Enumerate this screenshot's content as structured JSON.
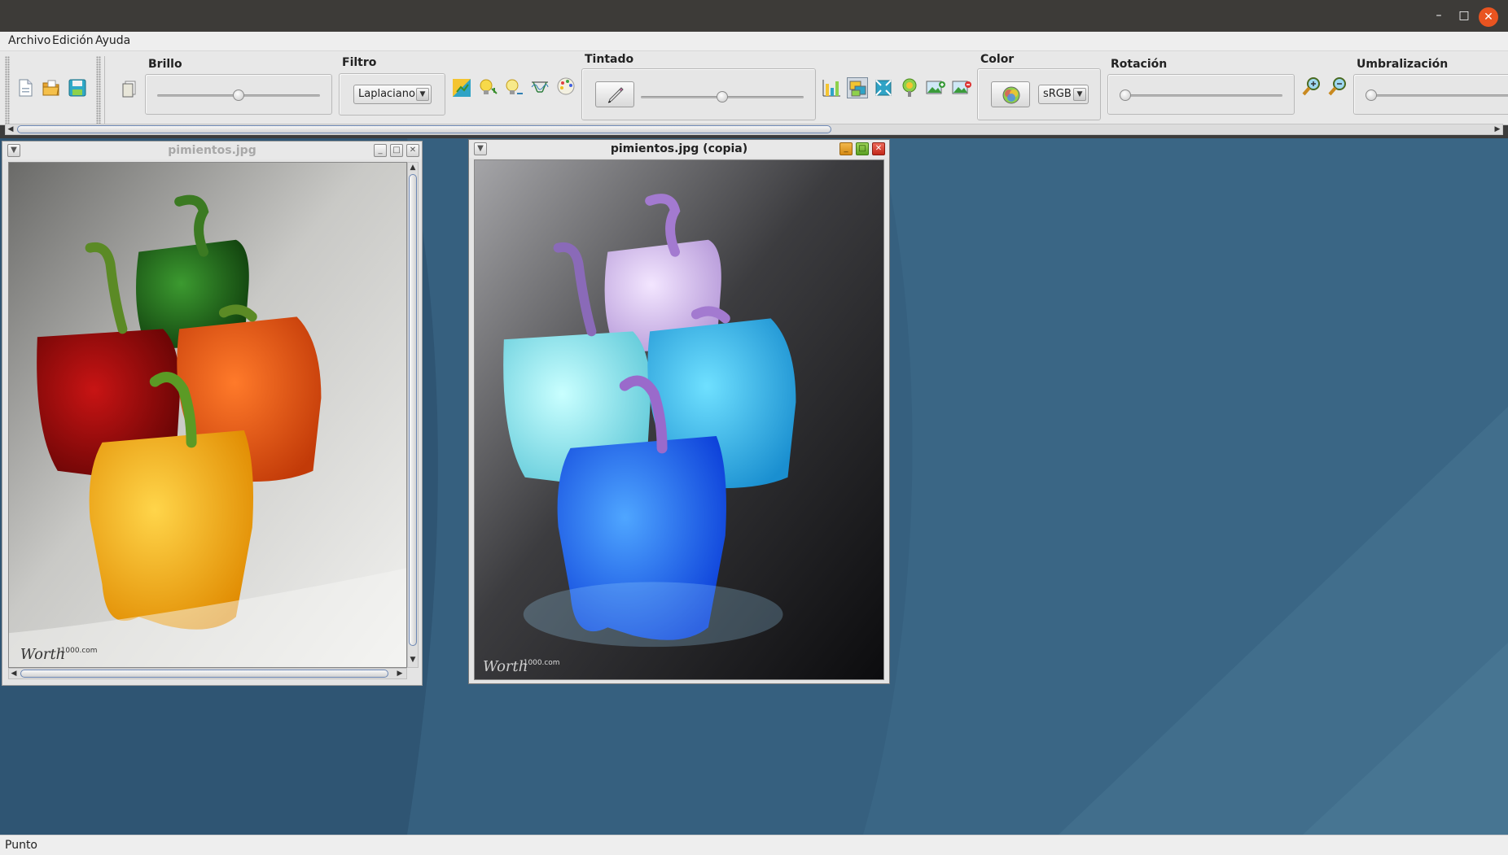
{
  "window": {
    "minimize_icon": "minimize-icon",
    "maximize_icon": "maximize-icon",
    "close_icon": "close-icon",
    "close_color": "#e95420"
  },
  "menu": {
    "items": [
      "Archivo",
      "Edición",
      "Ayuda"
    ]
  },
  "toolbar": {
    "file_buttons": [
      "new-file-icon",
      "open-file-icon",
      "save-file-icon"
    ],
    "brillo": {
      "title": "Brillo",
      "value_fraction": 0.5
    },
    "filtro": {
      "title": "Filtro",
      "selected": "Laplaciano"
    },
    "effects_buttons": [
      "contrast-icon",
      "light-bulb-icon",
      "dark-bulb-icon",
      "sine-wave-icon",
      "color-palette-icon"
    ],
    "tintado": {
      "title": "Tintado",
      "value_fraction": 0.5
    },
    "ops_buttons": [
      "histogram-icon",
      "band-split-icon",
      "scale-icon",
      "ycc-icon",
      "image-plus-icon",
      "image-minus-icon"
    ],
    "color": {
      "title": "Color",
      "selected": "sRGB"
    },
    "rotacion": {
      "title": "Rotación",
      "value_fraction": 0.0
    },
    "zoom_buttons": [
      "zoom-in-icon",
      "zoom-out-icon"
    ],
    "umbralizacion": {
      "title": "Umbralización",
      "value_fraction": 0.0
    }
  },
  "frames": [
    {
      "title": "pimientos.jpg",
      "active": false,
      "watermark": "1000.com"
    },
    {
      "title": "pimientos.jpg (copia)",
      "active": true,
      "watermark": "1000.com"
    }
  ],
  "status": {
    "text": "Punto"
  },
  "colors": {
    "desktop": "#2f5573",
    "titlebar": "#3d3b38",
    "accent": "#e95420"
  }
}
